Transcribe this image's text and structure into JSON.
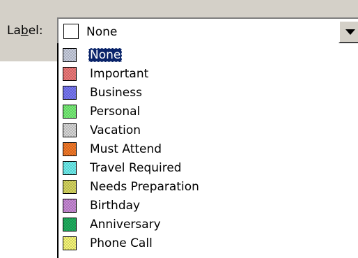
{
  "label_field": {
    "label": "Label:",
    "selected_value": "None"
  },
  "items": [
    {
      "label": "None",
      "color": "#c9cfe0",
      "selected": true
    },
    {
      "label": "Important",
      "color": "#f07a7a",
      "selected": false
    },
    {
      "label": "Business",
      "color": "#7878f5",
      "selected": false
    },
    {
      "label": "Personal",
      "color": "#78f078",
      "selected": false
    },
    {
      "label": "Vacation",
      "color": "#d8d8d8",
      "selected": false
    },
    {
      "label": "Must Attend",
      "color": "#f57a28",
      "selected": false
    },
    {
      "label": "Travel Required",
      "color": "#6ef0ef",
      "selected": false
    },
    {
      "label": "Needs Preparation",
      "color": "#d8d860",
      "selected": false
    },
    {
      "label": "Birthday",
      "color": "#c98ad8",
      "selected": false
    },
    {
      "label": "Anniversary",
      "color": "#20b060",
      "selected": false
    },
    {
      "label": "Phone Call",
      "color": "#f8f878",
      "selected": false
    }
  ]
}
